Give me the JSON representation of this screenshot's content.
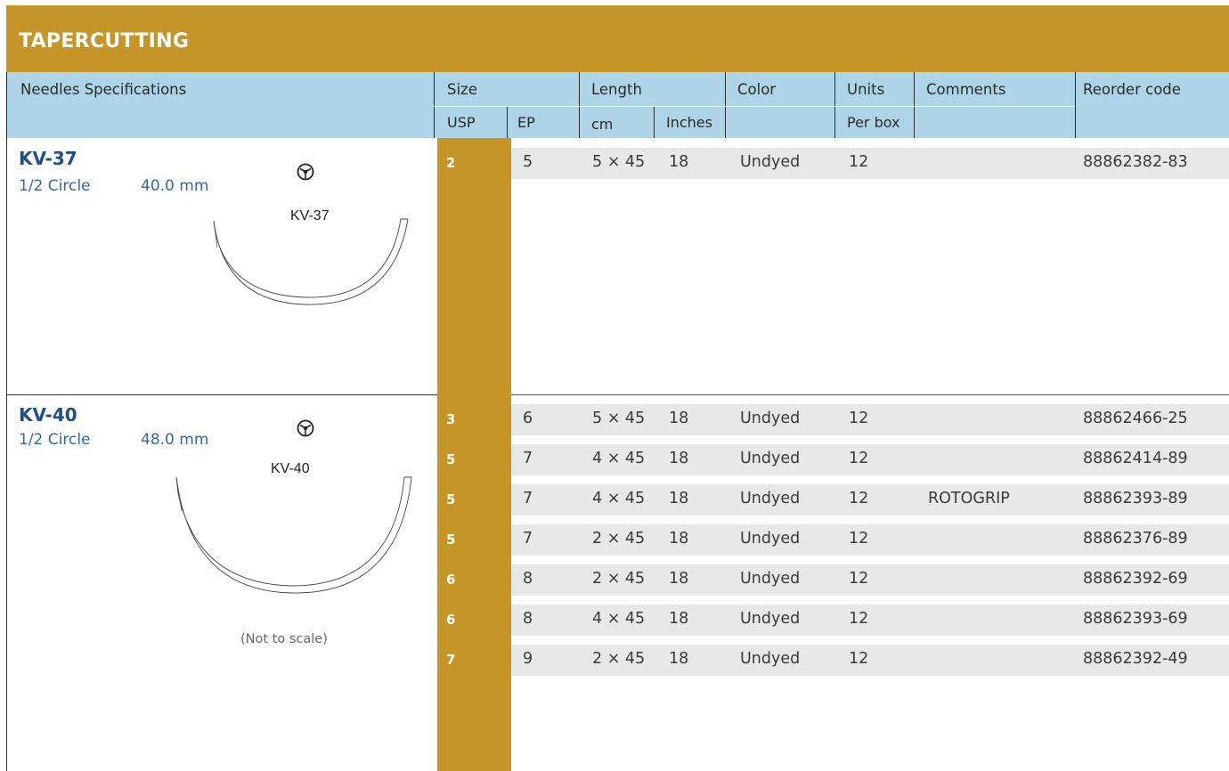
{
  "category_title": "TAPERCUTTING",
  "header": {
    "needles_spec": "Needles Specifications",
    "size": "Size",
    "usp": "USP",
    "ep": "EP",
    "length": "Length",
    "cm": "cm",
    "inches": "Inches",
    "color": "Color",
    "units": "Units",
    "per_box": "Per box",
    "comments": "Comments",
    "reorder_code": "Reorder code"
  },
  "needles": [
    {
      "name": "KV-37",
      "type": "1/2 Circle",
      "length": "40.0 mm",
      "label": "KV-37",
      "icon": "tapercut-point-icon",
      "rows": [
        {
          "usp": "2",
          "ep": "5",
          "cm": "5 × 45",
          "inches": "18",
          "color": "Undyed",
          "units": "12",
          "comments": "",
          "code": "88862382-83"
        }
      ]
    },
    {
      "name": "KV-40",
      "type": "1/2 Circle",
      "length": "48.0 mm",
      "label": "KV-40",
      "icon": "tapercut-point-icon",
      "note": "(Not to scale)",
      "rows": [
        {
          "usp": "3",
          "ep": "6",
          "cm": "5 × 45",
          "inches": "18",
          "color": "Undyed",
          "units": "12",
          "comments": "",
          "code": "88862466-25"
        },
        {
          "usp": "5",
          "ep": "7",
          "cm": "4 × 45",
          "inches": "18",
          "color": "Undyed",
          "units": "12",
          "comments": "",
          "code": "88862414-89"
        },
        {
          "usp": "5",
          "ep": "7",
          "cm": "4 × 45",
          "inches": "18",
          "color": "Undyed",
          "units": "12",
          "comments": "ROTOGRIP",
          "code": "88862393-89"
        },
        {
          "usp": "5",
          "ep": "7",
          "cm": "2 × 45",
          "inches": "18",
          "color": "Undyed",
          "units": "12",
          "comments": "",
          "code": "88862376-89"
        },
        {
          "usp": "6",
          "ep": "8",
          "cm": "2 × 45",
          "inches": "18",
          "color": "Undyed",
          "units": "12",
          "comments": "",
          "code": "88862392-69"
        },
        {
          "usp": "6",
          "ep": "8",
          "cm": "4 × 45",
          "inches": "18",
          "color": "Undyed",
          "units": "12",
          "comments": "",
          "code": "88862393-69"
        },
        {
          "usp": "7",
          "ep": "9",
          "cm": "2 × 45",
          "inches": "18",
          "color": "Undyed",
          "units": "12",
          "comments": "",
          "code": "88862392-49"
        }
      ]
    }
  ],
  "colors": {
    "gold": "#c59527",
    "header_blue": "#add5e7",
    "row_gray": "#e8e8e9",
    "name_blue": "#1e4e8c"
  }
}
